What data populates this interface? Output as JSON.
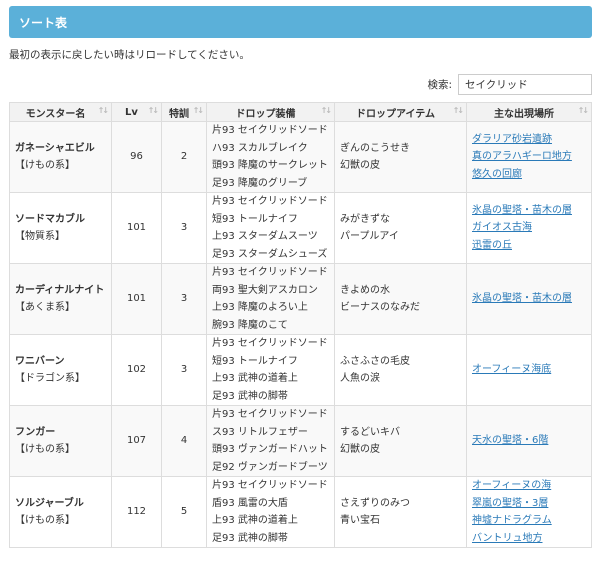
{
  "header": {
    "title": "ソート表"
  },
  "notice": "最初の表示に戻したい時はリロードしてください。",
  "search": {
    "label": "検索:",
    "value": "セイクリッド"
  },
  "columns": [
    "モンスター名",
    "Lv",
    "特訓",
    "ドロップ装備",
    "ドロップアイテム",
    "主な出現場所"
  ],
  "sort_icon": "sort-arrows-icon",
  "colors": {
    "header_bar": "#5bb0d9",
    "link": "#2a7ab8"
  },
  "rows": [
    {
      "name": "ガネーシャエビル",
      "category": "【けもの系】",
      "lv": "96",
      "training": "2",
      "equip": [
        "片93 セイクリッドソード",
        "ハ93 スカルブレイク",
        "頭93 降魔のサークレット",
        "足93 降魔のグリーブ"
      ],
      "items": [
        "ぎんのこうせき",
        "幻獣の皮"
      ],
      "locations": [
        "ダラリア砂岩遺跡",
        "真のアラハギーロ地方",
        "悠久の回廊"
      ]
    },
    {
      "name": "ソードマカブル",
      "category": "【物質系】",
      "lv": "101",
      "training": "3",
      "equip": [
        "片93 セイクリッドソード",
        "短93 トールナイフ",
        "上93 スターダムスーツ",
        "足93 スターダムシューズ"
      ],
      "items": [
        "みがきずな",
        "パープルアイ"
      ],
      "locations": [
        "氷晶の聖塔・苗木の層",
        "ガイオス古海",
        "迅雷の丘"
      ]
    },
    {
      "name": "カーディナルナイト",
      "category": "【あくま系】",
      "lv": "101",
      "training": "3",
      "equip": [
        "片93 セイクリッドソード",
        "両93 聖大剣アスカロン",
        "上93 降魔のよろい上",
        "腕93 降魔のこて"
      ],
      "items": [
        "きよめの水",
        "ビーナスのなみだ"
      ],
      "locations": [
        "氷晶の聖塔・苗木の層"
      ]
    },
    {
      "name": "ワニバーン",
      "category": "【ドラゴン系】",
      "lv": "102",
      "training": "3",
      "equip": [
        "片93 セイクリッドソード",
        "短93 トールナイフ",
        "上93 武神の道着上",
        "足93 武神の脚帯"
      ],
      "items": [
        "ふさふさの毛皮",
        "人魚の涙"
      ],
      "locations": [
        "オーフィーヌ海底"
      ]
    },
    {
      "name": "フンガー",
      "category": "【けもの系】",
      "lv": "107",
      "training": "4",
      "equip": [
        "片93 セイクリッドソード",
        "ス93 リトルフェザー",
        "頭93 ヴァンガードハット",
        "足92 ヴァンガードブーツ"
      ],
      "items": [
        "するどいキバ",
        "幻獣の皮"
      ],
      "locations": [
        "天水の聖塔・6階"
      ]
    },
    {
      "name": "ソルジャーブル",
      "category": "【けもの系】",
      "lv": "112",
      "training": "5",
      "equip": [
        "片93 セイクリッドソード",
        "盾93 風雷の大盾",
        "上93 武神の道着上",
        "足93 武神の脚帯"
      ],
      "items": [
        "さえずりのみつ",
        "青い宝石"
      ],
      "locations": [
        "オーフィーヌの海",
        "翠嵐の聖塔・3層",
        "神墟ナドラグラム",
        "バントリュ地方"
      ]
    }
  ]
}
